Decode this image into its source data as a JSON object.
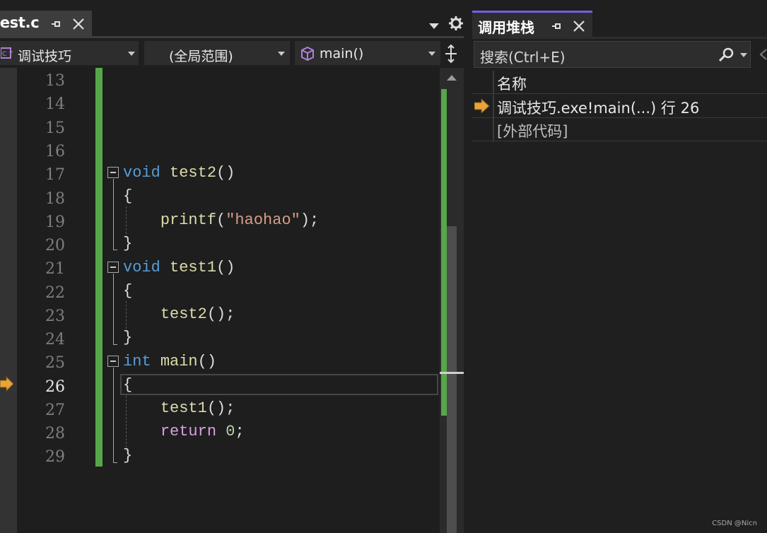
{
  "editor_tab": {
    "label": "test.c"
  },
  "navbar": {
    "project": "调试技巧",
    "scope": "(全局范围)",
    "function": "main()"
  },
  "editor": {
    "current_line": 26,
    "line_numbers": [
      "13",
      "14",
      "15",
      "16",
      "17",
      "18",
      "19",
      "20",
      "21",
      "22",
      "23",
      "24",
      "25",
      "26",
      "27",
      "28",
      "29"
    ]
  },
  "callstack": {
    "tab_label": "调用堆栈",
    "search_placeholder": "搜索(Ctrl+E)",
    "column_header": "名称",
    "frames": [
      {
        "text": "调试技巧.exe!main(...) 行 26",
        "current": true
      },
      {
        "text": "[外部代码]",
        "current": false
      }
    ]
  },
  "watermark": "CSDN @Nicn",
  "colors": {
    "accent": "#7160e8",
    "change_bar": "#57a64a",
    "keyword": "#569cd6",
    "control_keyword": "#d8a0df",
    "function": "#dcdcaa",
    "string": "#d69d85",
    "exec_arrow": "#e8a33a"
  }
}
